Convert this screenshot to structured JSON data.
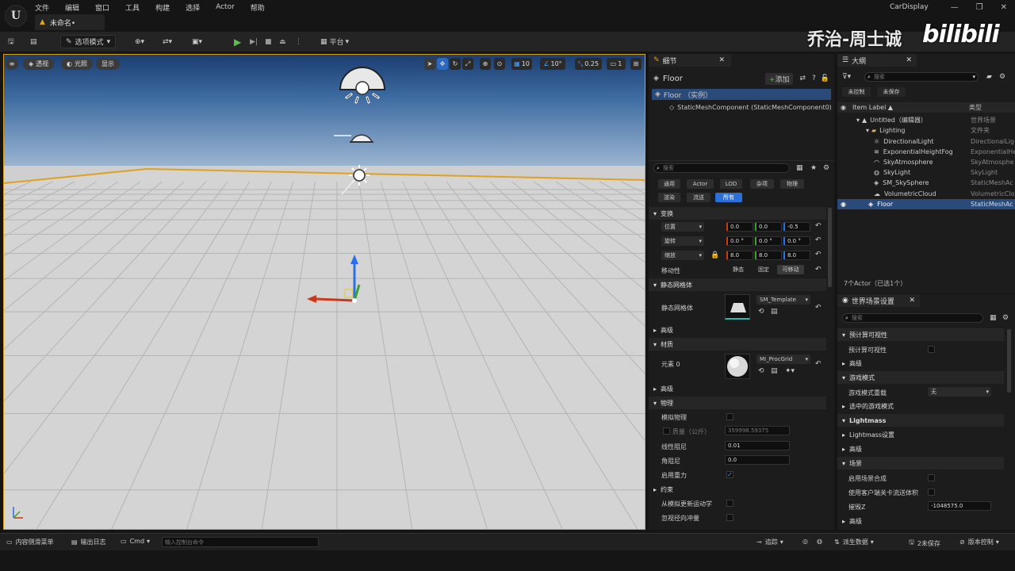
{
  "menu": [
    "文件",
    "编辑",
    "窗口",
    "工具",
    "构建",
    "选择",
    "Actor",
    "帮助"
  ],
  "doc_tab": "未命名•",
  "app_name": "CarDisplay",
  "watermark": {
    "name": "乔治-周士诚",
    "brand": "bilibili"
  },
  "toolbar": {
    "mode": "选项模式",
    "platform": "平台"
  },
  "viewport": {
    "perspective": "透视",
    "lit": "光照",
    "show": "显示",
    "grid_snap": "10",
    "rot_snap": "10°",
    "scale_snap": "0.25",
    "camera_speed": "1"
  },
  "details": {
    "tab": "细节",
    "actor_name": "Floor",
    "add_label": "添加",
    "instance_label": "Floor （实例）",
    "component": "StaticMeshComponent (StaticMeshComponent0)",
    "search_placeholder": "搜索",
    "filters": [
      "通用",
      "Actor",
      "LOD",
      "杂项",
      "物理",
      "渲染",
      "流送",
      "所有"
    ],
    "transform": {
      "section": "变换",
      "location_label": "位置",
      "rotation_label": "旋转",
      "scale_label": "缩放",
      "location": [
        "0.0",
        "0.0",
        "-0.5"
      ],
      "rotation": [
        "0.0 °",
        "0.0 °",
        "0.0 °"
      ],
      "scale": [
        "8.0",
        "8.0",
        "8.0"
      ],
      "mobility_label": "移动性",
      "mobility_options": [
        "静态",
        "固定",
        "可移动"
      ]
    },
    "static_mesh": {
      "section": "静态网格体",
      "label": "静态网格体",
      "value": "SM_Template"
    },
    "advanced": "高级",
    "materials": {
      "section": "材质",
      "element_label": "元素 0",
      "value": "MI_ProcGrid"
    },
    "physics": {
      "section": "物理",
      "simulate": "模拟物理",
      "mass_label": "质量（公斤）",
      "mass_value": "359998.59375",
      "linear_damping_label": "线性阻尼",
      "linear_damping": "0.01",
      "angular_damping_label": "角阻尼",
      "angular_damping": "0.0",
      "gravity_label": "启用重力"
    },
    "constraints": {
      "section": "约束",
      "item1": "从模拟更新运动学",
      "item2": "忽视径向冲量"
    }
  },
  "outliner": {
    "tab": "大纲",
    "search_placeholder": "搜索",
    "chips": [
      "未控制",
      "未保存"
    ],
    "col_label": "Item Label ▲",
    "col_type": "类型",
    "rows": [
      {
        "label": "Untitled（编辑器）",
        "type": "世界场景"
      },
      {
        "label": "Lighting",
        "type": "文件夹"
      },
      {
        "label": "DirectionalLight",
        "type": "DirectionalLig"
      },
      {
        "label": "ExponentialHeightFog",
        "type": "ExponentialHe"
      },
      {
        "label": "SkyAtmosphere",
        "type": "SkyAtmosphe"
      },
      {
        "label": "SkyLight",
        "type": "SkyLight"
      },
      {
        "label": "SM_SkySphere",
        "type": "StaticMeshAc"
      },
      {
        "label": "VolumetricCloud",
        "type": "VolumetricClo"
      },
      {
        "label": "Floor",
        "type": "StaticMeshAc"
      }
    ],
    "count": "7个Actor（已选1个）"
  },
  "world": {
    "tab": "世界场景设置",
    "search_placeholder": "搜索",
    "s1": "预计算可视性",
    "s1_item": "预计算可视性",
    "adv": "高级",
    "s2": "游戏模式",
    "gm_label": "游戏模式重载",
    "gm_value": "无",
    "selected_gm": "选中的游戏模式",
    "s3": "Lightmass",
    "lm_settings": "Lightmass设置",
    "s4": "场景",
    "comp_label": "启用场景合成",
    "client_label": "使用客户端关卡流送体积",
    "killz_label": "摧毁Z",
    "killz_value": "-1048575.0"
  },
  "status": {
    "drawer": "内容侧滑菜单",
    "log": "输出日志",
    "cmd": "Cmd",
    "cmd_placeholder": "输入控制台命令",
    "trace": "追踪",
    "derived": "派生数据",
    "unsaved": "2未保存",
    "source": "版本控制"
  }
}
